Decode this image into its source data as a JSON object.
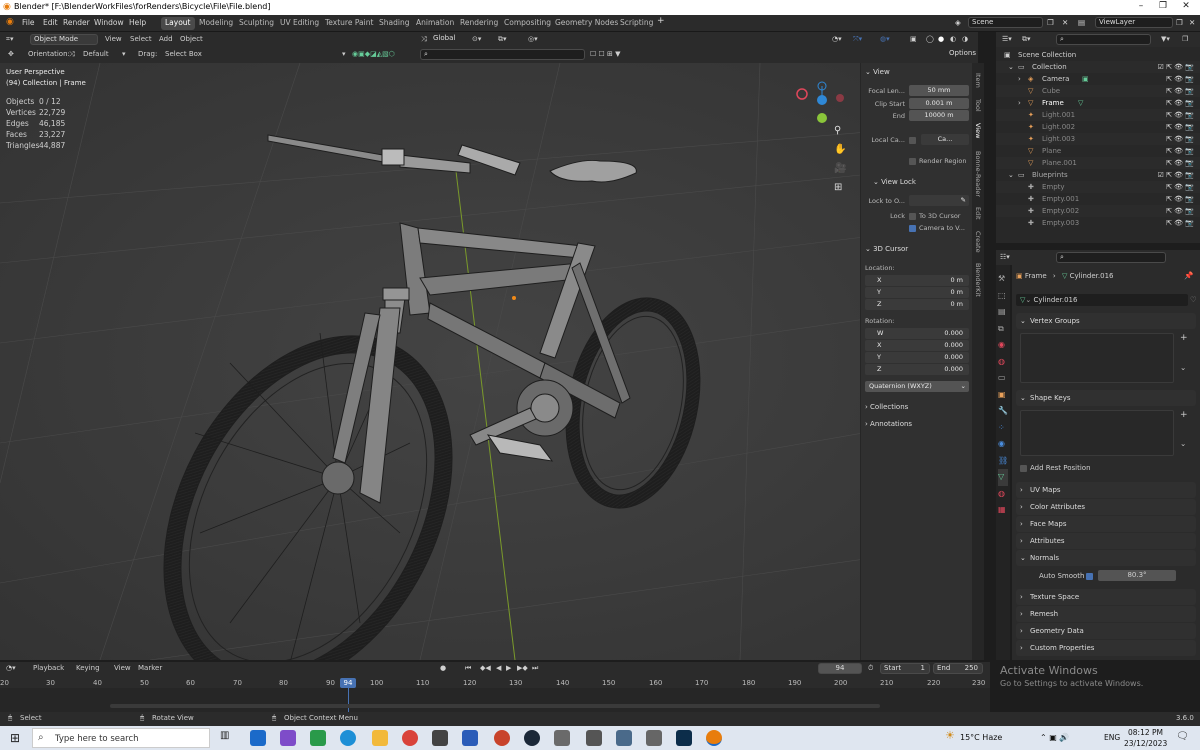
{
  "titlebar": {
    "title": "Blender* [F:\\BlenderWorkFiles\\forRenders\\Bicycle\\File\\File.blend]"
  },
  "menu": {
    "items": [
      "File",
      "Edit",
      "Render",
      "Window",
      "Help"
    ]
  },
  "workspaces": [
    "Layout",
    "Modeling",
    "Sculpting",
    "UV Editing",
    "Texture Paint",
    "Shading",
    "Animation",
    "Rendering",
    "Compositing",
    "Geometry Nodes",
    "Scripting"
  ],
  "scene": {
    "scene_label": "Scene",
    "view_layer_label": "ViewLayer"
  },
  "viewport_header": {
    "mode": "Object Mode",
    "view": "View",
    "select": "Select",
    "add": "Add",
    "object": "Object",
    "transform_orientation": "Global",
    "options": "Options"
  },
  "toolsettings": {
    "orientation_label": "Orientation:",
    "orientation_value": "Default",
    "drag_label": "Drag:",
    "drag_value": "Select Box"
  },
  "viewport": {
    "perspective": "User Perspective",
    "context": "(94) Collection | Frame"
  },
  "stats": [
    {
      "label": "Objects",
      "value": "0 / 12"
    },
    {
      "label": "Vertices",
      "value": "22,729"
    },
    {
      "label": "Edges",
      "value": "46,185"
    },
    {
      "label": "Faces",
      "value": "23,227"
    },
    {
      "label": "Triangles",
      "value": "44,887"
    }
  ],
  "npanel": {
    "view_header": "View",
    "focal_label": "Focal Len...",
    "focal_value": "50 mm",
    "clip_start_label": "Clip Start",
    "clip_start_value": "0.001 m",
    "clip_end_label": "End",
    "clip_end_value": "10000 m",
    "local_camera_label": "Local Ca...",
    "local_camera_value": "Ca...",
    "render_region": "Render Region",
    "view_lock_header": "View Lock",
    "lock_to_object_label": "Lock to O...",
    "lock_label": "Lock",
    "to_3d_cursor": "To 3D Cursor",
    "camera_to_view": "Camera to V...",
    "cursor_header": "3D Cursor",
    "location_label": "Location:",
    "loc_x": "0 m",
    "loc_y": "0 m",
    "loc_z": "0 m",
    "rotation_label": "Rotation:",
    "rot_w": "0.000",
    "rot_x": "0.000",
    "rot_y": "0.000",
    "rot_z": "0.000",
    "rotation_mode": "Quaternion (WXYZ)",
    "collections": "Collections",
    "annotations": "Annotations",
    "axis_w": "W",
    "axis_x": "X",
    "axis_y": "Y",
    "axis_z": "Z"
  },
  "sidetabs": [
    "Item",
    "Tool",
    "View",
    "Bonne-Reader",
    "Edit",
    "Create",
    "BlenderKit"
  ],
  "outliner": {
    "root": "Scene Collection",
    "items": [
      {
        "name": "Collection",
        "depth": 1
      },
      {
        "name": "Camera",
        "depth": 2
      },
      {
        "name": "Cube",
        "depth": 2
      },
      {
        "name": "Frame",
        "depth": 2
      },
      {
        "name": "Light.001",
        "depth": 2
      },
      {
        "name": "Light.002",
        "depth": 2
      },
      {
        "name": "Light.003",
        "depth": 2
      },
      {
        "name": "Plane",
        "depth": 2
      },
      {
        "name": "Plane.001",
        "depth": 2
      },
      {
        "name": "Blueprints",
        "depth": 1
      },
      {
        "name": "Empty",
        "depth": 2
      },
      {
        "name": "Empty.001",
        "depth": 2
      },
      {
        "name": "Empty.002",
        "depth": 2
      },
      {
        "name": "Empty.003",
        "depth": 2
      }
    ]
  },
  "properties": {
    "object": "Frame",
    "mesh": "Cylinder.016",
    "datablock": "Cylinder.016",
    "vertex_groups": "Vertex Groups",
    "shape_keys": "Shape Keys",
    "add_rest_position": "Add Rest Position",
    "uv_maps": "UV Maps",
    "color_attributes": "Color Attributes",
    "face_maps": "Face Maps",
    "attributes": "Attributes",
    "normals": "Normals",
    "auto_smooth_label": "Auto Smooth",
    "auto_smooth_value": "80.3°",
    "texture_space": "Texture Space",
    "remesh": "Remesh",
    "geometry_data": "Geometry Data",
    "custom_properties": "Custom Properties"
  },
  "timeline": {
    "playback": "Playback",
    "keying": "Keying",
    "view": "View",
    "marker": "Marker",
    "current_frame": "94",
    "start_label": "Start",
    "start_value": "1",
    "end_label": "End",
    "end_value": "250",
    "ticks": [
      "20",
      "30",
      "40",
      "50",
      "60",
      "70",
      "80",
      "90",
      "100",
      "110",
      "120",
      "130",
      "140",
      "150",
      "160",
      "170",
      "180",
      "190",
      "200",
      "210",
      "220",
      "230"
    ]
  },
  "statusbar": {
    "select": "Select",
    "rotate": "Rotate View",
    "context_menu": "Object Context Menu",
    "version": "3.6.0"
  },
  "activate": {
    "title": "Activate Windows",
    "subtitle": "Go to Settings to activate Windows."
  },
  "taskbar": {
    "search_placeholder": "Type here to search",
    "weather": "15°C  Haze",
    "language": "ENG",
    "time": "08:12 PM",
    "date": "23/12/2023"
  },
  "colors": {
    "accent": "#4772b3",
    "viewport_bg": "#3d3d3d",
    "axis_x": "#e0475b",
    "axis_y": "#8ac53a",
    "axis_z": "#2f88d6"
  }
}
